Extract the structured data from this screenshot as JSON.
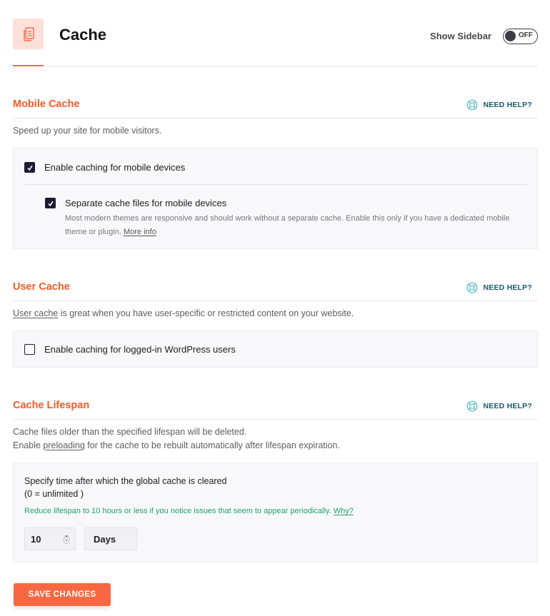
{
  "header": {
    "title": "Cache",
    "icon": "document-copy-icon",
    "show_sidebar_label": "Show Sidebar",
    "sidebar_toggle_state": "OFF"
  },
  "colors": {
    "accent": "#f35a25",
    "button": "#f76842",
    "help": "#155a6b",
    "hint": "#22a06b",
    "checkbox": "#1d1a33"
  },
  "sections": {
    "mobile": {
      "title": "Mobile Cache",
      "help_label": "NEED HELP?",
      "description": "Speed up your site for mobile visitors.",
      "option1": {
        "label": "Enable caching for mobile devices",
        "checked": true
      },
      "option2": {
        "label": "Separate cache files for mobile devices",
        "checked": true,
        "description": "Most modern themes are responsive and should work without a separate cache. Enable this only if you have a dedicated mobile theme or plugin.",
        "link": "More info"
      }
    },
    "user": {
      "title": "User Cache",
      "help_label": "NEED HELP?",
      "description_link": "User cache",
      "description_rest": " is great when you have user-specific or restricted content on your website.",
      "option1": {
        "label": "Enable caching for logged-in WordPress users",
        "checked": false
      }
    },
    "lifespan": {
      "title": "Cache Lifespan",
      "help_label": "NEED HELP?",
      "description_line1": "Cache files older than the specified lifespan will be deleted.",
      "description_line2_pre": "Enable ",
      "description_line2_link": "preloading",
      "description_line2_post": " for the cache to be rebuilt automatically after lifespan expiration.",
      "field_label": "Specify time after which the global cache is cleared",
      "field_note": "(0 = unlimited )",
      "hint": "Reduce lifespan to 10 hours or less if you notice issues that seem to appear periodically.",
      "hint_link": "Why?",
      "value": "10",
      "unit": "Days"
    }
  },
  "footer": {
    "save_label": "SAVE CHANGES"
  }
}
